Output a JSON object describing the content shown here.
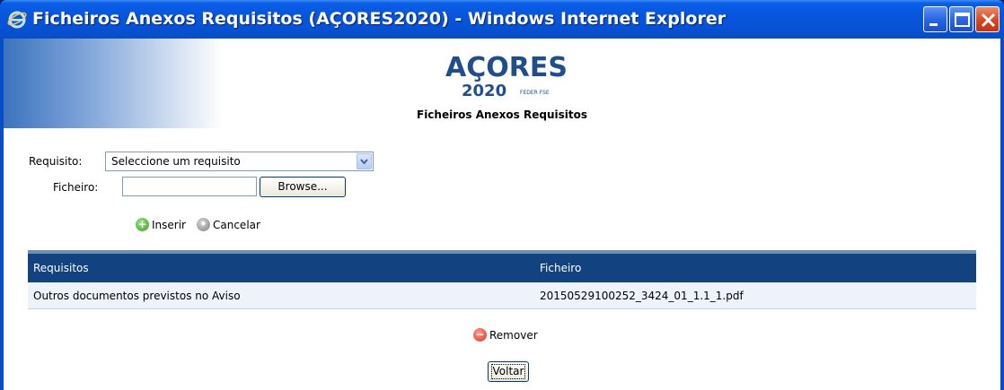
{
  "window": {
    "title": "Ficheiros Anexos Requisitos (AÇORES2020) - Windows Internet Explorer"
  },
  "header": {
    "logo_main": "AÇORES",
    "logo_year": "2020",
    "logo_tag": "FEDER FSE",
    "page_title": "Ficheiros Anexos Requisitos"
  },
  "form": {
    "requisito_label": "Requisito:",
    "requisito_value": "Seleccione um requisito",
    "ficheiro_label": "Ficheiro:",
    "ficheiro_value": "",
    "browse_label": "Browse...",
    "inserir_label": "Inserir",
    "cancelar_label": "Cancelar"
  },
  "table": {
    "columns": [
      "Requisitos",
      "Ficheiro"
    ],
    "rows": [
      {
        "requisito": "Outros documentos previstos no Aviso",
        "ficheiro": "20150529100252_3424_01_1.1_1.pdf"
      }
    ]
  },
  "actions": {
    "remover_label": "Remover",
    "voltar_label": "Voltar"
  },
  "colors": {
    "titlebar": "#0855dd",
    "table_header": "#12427f",
    "row_bg": "#eef3fb"
  },
  "icons": [
    "ie-icon",
    "minimize-icon",
    "maximize-icon",
    "close-icon",
    "dropdown-arrow-icon",
    "add-icon",
    "cancel-icon",
    "remove-icon"
  ]
}
